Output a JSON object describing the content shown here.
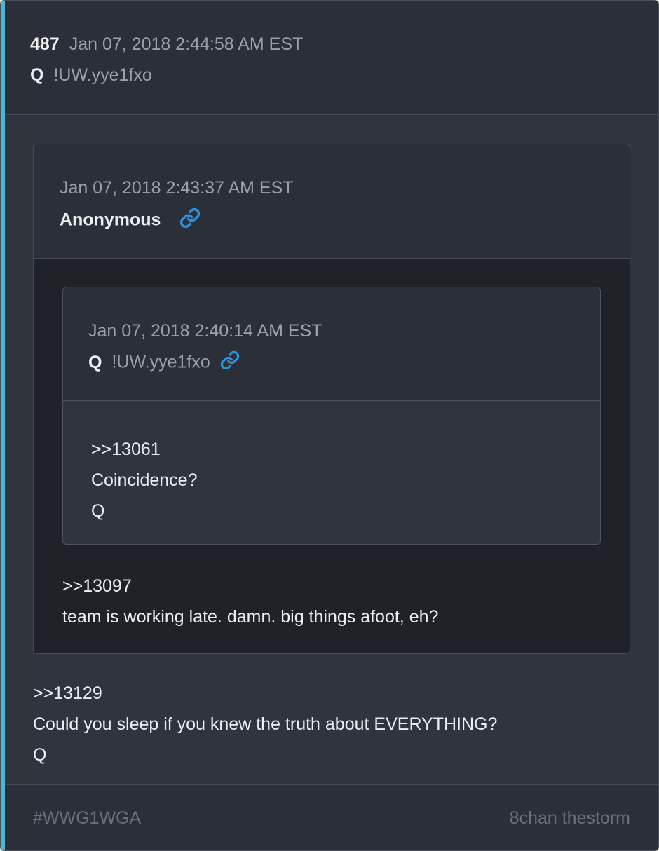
{
  "post": {
    "number": "487",
    "timestamp": "Jan 07, 2018 2:44:58 AM EST",
    "name": "Q",
    "tripcode": "!UW.yye1fxo"
  },
  "quote_outer": {
    "timestamp": "Jan 07, 2018 2:43:37 AM EST",
    "name": "Anonymous",
    "link_icon": "link-icon",
    "lines": [
      ">>13097",
      "team is working late. damn. big things afoot, eh?"
    ]
  },
  "quote_inner": {
    "timestamp": "Jan 07, 2018 2:40:14 AM EST",
    "name": "Q",
    "tripcode": "!UW.yye1fxo",
    "link_icon": "link-icon",
    "lines": [
      ">>13061",
      "Coincidence?",
      "Q"
    ]
  },
  "body": {
    "lines": [
      ">>13129",
      "Could you sleep if you knew the truth about EVERYTHING?",
      "Q"
    ]
  },
  "footer": {
    "tag": "#WWG1WGA",
    "source": "8chan thestorm"
  },
  "colors": {
    "accent": "#4ab8d4",
    "link": "#2f8fd8",
    "card_bg": "#2f343d",
    "quote_bg": "#1f2228"
  }
}
